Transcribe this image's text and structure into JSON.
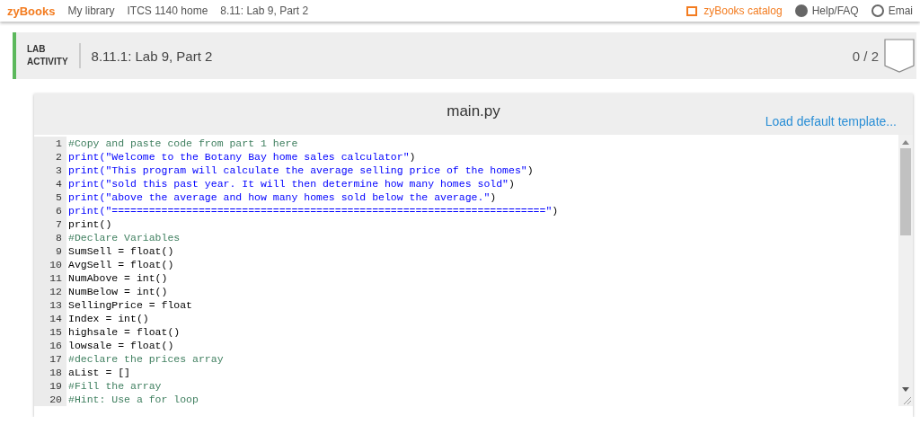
{
  "nav": {
    "logo": "zyBooks",
    "crumbs": [
      "My library",
      "ITCS 1140 home",
      "8.11: Lab 9, Part 2"
    ],
    "links": [
      {
        "kind": "catalog",
        "label": "zyBooks catalog"
      },
      {
        "kind": "help",
        "label": "Help/FAQ"
      },
      {
        "kind": "user",
        "label": "Emai"
      }
    ]
  },
  "activity": {
    "type_label": [
      "LAB",
      "ACTIVITY"
    ],
    "title": "8.11.1: Lab 9, Part 2",
    "score": "0 / 2"
  },
  "editor": {
    "filename": "main.py",
    "template_link": "Load default template...",
    "lines": [
      {
        "number": "1",
        "tokens": [
          {
            "kind": "comment",
            "text": "#Copy and paste code from part 1 here"
          }
        ]
      },
      {
        "number": "2",
        "tokens": [
          {
            "kind": "string",
            "text": "print(\"Welcome to the Botany Bay home sales calculator\""
          },
          {
            "kind": "plain",
            "text": ")"
          }
        ]
      },
      {
        "number": "3",
        "tokens": [
          {
            "kind": "string",
            "text": "print(\"This program will calculate the average selling price of the homes\""
          },
          {
            "kind": "plain",
            "text": ")"
          }
        ]
      },
      {
        "number": "4",
        "tokens": [
          {
            "kind": "string",
            "text": "print(\"sold this past year. It will then determine how many homes sold\""
          },
          {
            "kind": "plain",
            "text": ")"
          }
        ]
      },
      {
        "number": "5",
        "tokens": [
          {
            "kind": "string",
            "text": "print(\"above the average and how many homes sold below the average.\""
          },
          {
            "kind": "plain",
            "text": ")"
          }
        ]
      },
      {
        "number": "6",
        "tokens": [
          {
            "kind": "string",
            "text": "print(\"======================================================================\""
          },
          {
            "kind": "plain",
            "text": ")"
          }
        ]
      },
      {
        "number": "7",
        "tokens": [
          {
            "kind": "plain",
            "text": "print()"
          }
        ]
      },
      {
        "number": "8",
        "tokens": [
          {
            "kind": "comment",
            "text": "#Declare Variables"
          }
        ]
      },
      {
        "number": "9",
        "tokens": [
          {
            "kind": "plain",
            "text": "SumSell = float()"
          }
        ]
      },
      {
        "number": "10",
        "tokens": [
          {
            "kind": "plain",
            "text": "AvgSell = float()"
          }
        ]
      },
      {
        "number": "11",
        "tokens": [
          {
            "kind": "plain",
            "text": "NumAbove = int()"
          }
        ]
      },
      {
        "number": "12",
        "tokens": [
          {
            "kind": "plain",
            "text": "NumBelow = int()"
          }
        ]
      },
      {
        "number": "13",
        "tokens": [
          {
            "kind": "plain",
            "text": "SellingPrice = float"
          }
        ]
      },
      {
        "number": "14",
        "tokens": [
          {
            "kind": "plain",
            "text": "Index = int()"
          }
        ]
      },
      {
        "number": "15",
        "tokens": [
          {
            "kind": "plain",
            "text": "highsale = float()"
          }
        ]
      },
      {
        "number": "16",
        "tokens": [
          {
            "kind": "plain",
            "text": "lowsale = float()"
          }
        ]
      },
      {
        "number": "17",
        "tokens": [
          {
            "kind": "comment",
            "text": "#declare the prices array"
          }
        ]
      },
      {
        "number": "18",
        "tokens": [
          {
            "kind": "plain",
            "text": "aList = []"
          }
        ]
      },
      {
        "number": "19",
        "tokens": [
          {
            "kind": "comment",
            "text": "#Fill the array"
          }
        ]
      },
      {
        "number": "20",
        "tokens": [
          {
            "kind": "comment",
            "text": "#Hint: Use a for loop"
          }
        ]
      }
    ]
  }
}
